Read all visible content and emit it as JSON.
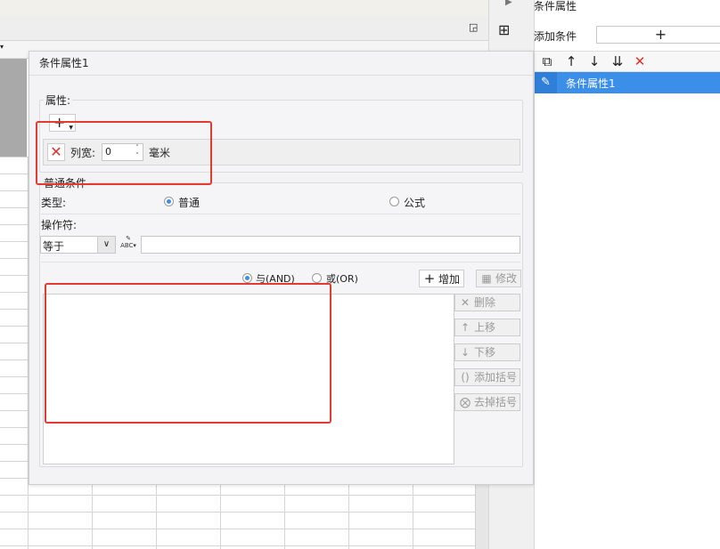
{
  "right_panel": {
    "title": "条件属性",
    "add_condition_label": "添加条件",
    "add_button": "+",
    "toolbar_icons": [
      "copy-icon",
      "arrow-up-icon",
      "arrow-down-icon",
      "move-bottom-icon",
      "delete-icon"
    ],
    "items": [
      {
        "label": "条件属性1",
        "selected": true,
        "icon": "pencil-icon"
      }
    ]
  },
  "dialog": {
    "title": "条件属性1",
    "attributes_legend": "属性:",
    "add_attr_button": "+",
    "column_width": {
      "label": "列宽:",
      "value": "0",
      "unit": "毫米"
    },
    "normal_conditions_legend": "普通条件",
    "type_label": "类型:",
    "type_options": [
      {
        "label": "普通",
        "selected": true
      },
      {
        "label": "公式",
        "selected": false
      }
    ],
    "operator_label": "操作符:",
    "operator_value": "等于",
    "operand_value": "",
    "and_label": "与(AND)",
    "or_label": "或(OR)",
    "logic_selected": "AND",
    "buttons": {
      "add": "增加",
      "modify": "修改",
      "delete": "删除",
      "move_up": "上移",
      "move_down": "下移",
      "add_parenthesis": "添加括号",
      "remove_parenthesis": "去掉括号"
    }
  },
  "colors": {
    "selection_blue": "#3c8fe8",
    "delete_red": "#e0302a",
    "annotation_red": "#e53a2f"
  }
}
